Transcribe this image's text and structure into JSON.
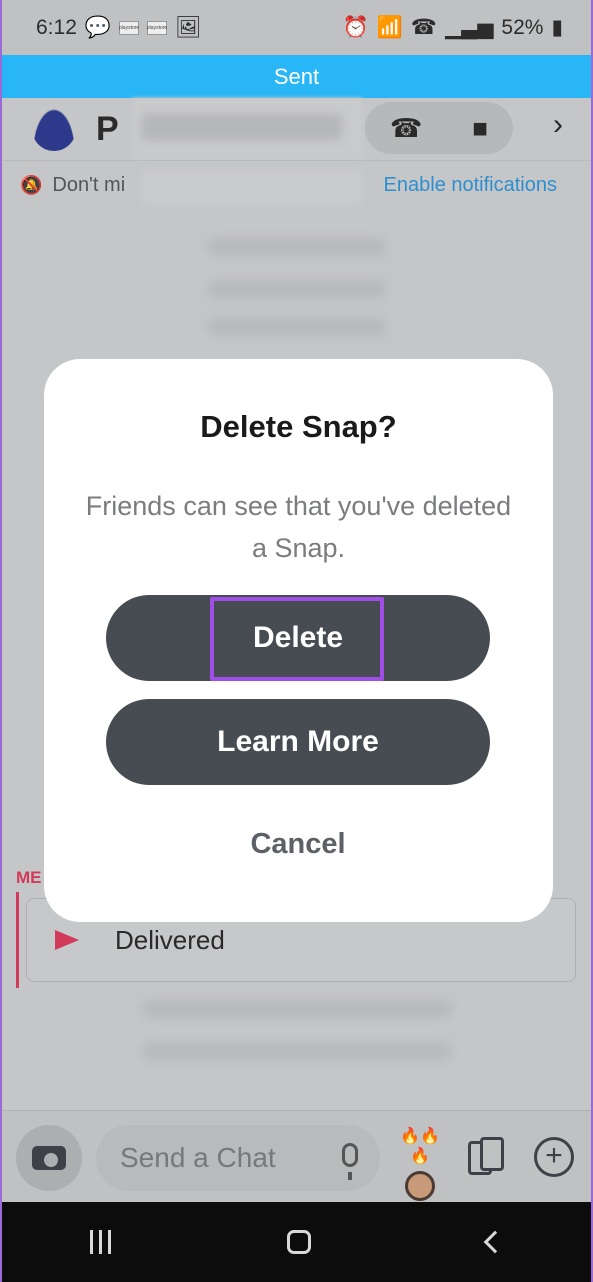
{
  "status_bar": {
    "time": "6:12",
    "battery": "52%",
    "mini_tile_1": "playstore",
    "mini_tile_2": "playstore"
  },
  "banner": {
    "text": "Sent"
  },
  "chat_header": {
    "name_initial": "P"
  },
  "notification_bar": {
    "text": "Don't mi",
    "link": "Enable notifications"
  },
  "messages": {
    "sender_label": "ME",
    "status": "Delivered"
  },
  "chat_bar": {
    "placeholder": "Send a Chat",
    "bitmoji_fire": "🔥🔥🔥"
  },
  "dialog": {
    "title": "Delete Snap?",
    "message": "Friends can see that you've deleted a Snap.",
    "delete_label": "Delete",
    "learn_more_label": "Learn More",
    "cancel_label": "Cancel",
    "highlight_color": "#a04ee8"
  },
  "colors": {
    "banner": "#29b6f6",
    "accent_red": "#d23a5a",
    "button_dark": "#474b52",
    "link_blue": "#2d8fd0"
  }
}
